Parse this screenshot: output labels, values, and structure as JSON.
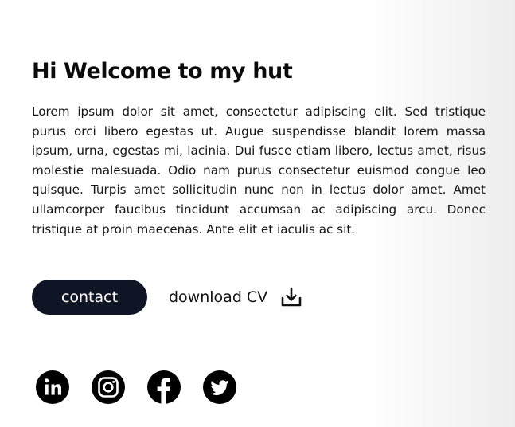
{
  "hero": {
    "headline": "Hi Welcome to my hut",
    "paragraph": "Lorem ipsum dolor sit amet, consectetur adipiscing elit. Sed tristique purus orci libero egestas ut. Augue suspendisse blandit lorem massa ipsum, urna, egestas mi, lacinia. Dui fusce etiam libero, lectus amet, risus molestie malesuada. Odio nam purus consectetur euismod congue leo quisque. Turpis amet sollicitudin nunc non in lectus dolor amet. Amet ullamcorper faucibus tincidunt accumsan ac adipiscing arcu. Donec tristique at proin maecenas. Ante elit et iaculis ac sit."
  },
  "actions": {
    "contact_label": "contact",
    "download_label": "download CV",
    "download_icon": "download-icon"
  },
  "socials": [
    {
      "icon": "linkedin-icon"
    },
    {
      "icon": "instagram-icon"
    },
    {
      "icon": "facebook-icon"
    },
    {
      "icon": "twitter-icon"
    }
  ],
  "colors": {
    "button_bg": "#0f1525",
    "button_text": "#ffffff",
    "text": "#111111",
    "icon": "#000000"
  }
}
